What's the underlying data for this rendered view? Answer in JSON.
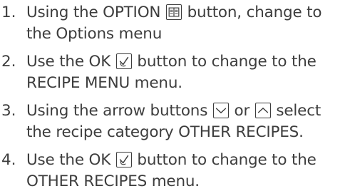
{
  "steps": [
    {
      "number": "1.",
      "line1_pre": "Using the OPTION ",
      "line1_icon": "book-icon",
      "line1_post": " button, change to",
      "line2": "the Options menu"
    },
    {
      "number": "2.",
      "line1_pre": "Use the OK ",
      "line1_icon": "ok-check-icon",
      "line1_post": " button to change to the",
      "line2": "RECIPE MENU menu."
    },
    {
      "number": "3.",
      "line1_pre": "Using the arrow buttons ",
      "line1_icon_a": "arrow-down-icon",
      "line1_mid": " or ",
      "line1_icon_b": "arrow-up-icon",
      "line1_post": " select",
      "line2": "the recipe category OTHER RECIPES."
    },
    {
      "number": "4.",
      "line1_pre": "Use the OK ",
      "line1_icon": "ok-check-icon",
      "line1_post": " button to change to the",
      "line2": "OTHER RECIPES menu."
    }
  ]
}
